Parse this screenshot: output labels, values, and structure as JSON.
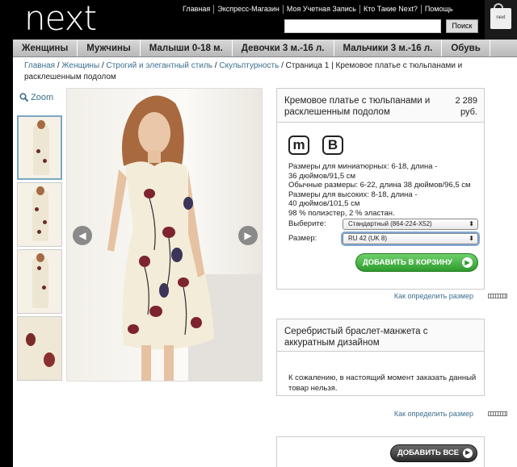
{
  "header": {
    "logo": "next",
    "links": [
      "Главная",
      "Экспресс-Магазин",
      "Моя Учетная Запись",
      "Кто Такие Next?",
      "Помощь"
    ],
    "search_button": "Поиск",
    "bag_label": "next"
  },
  "nav": [
    "Женщины",
    "Мужчины",
    "Малыши 0-18 м.",
    "Девочки 3 м.-16 л.",
    "Мальчики 3 м.-16 л.",
    "Обувь"
  ],
  "breadcrumb": {
    "links": [
      "Главная",
      "Женщины",
      "Строгий и элегантный стиль",
      "Скульптурность"
    ],
    "rest": "Страница 1  |  Кремовое платье с тюльпанами и расклешенным подолом"
  },
  "zoom": "Zoom",
  "gallery": {
    "prev": "◀",
    "next": "▶"
  },
  "product": {
    "title": "Кремовое платье с тюльпанами и расклешенным подолом",
    "price_value": "2 289",
    "price_unit": "руб.",
    "icon_m": "m",
    "icon_b": "B",
    "desc_lines": [
      "Размеры для миниатюрных: 6-18, длина -",
      "36 дюймов/91,5 см",
      "Обычные размеры: 6-22, длина 38 дюймов/96,5 см",
      "Размеры для высоких: 8-18, длина -",
      "40 дюймов/101,5 см",
      "98 % полиэстер, 2 % эластан."
    ],
    "choose_label": "Выберите:",
    "choose_value": "Стандартный (864-224-X52)",
    "size_label": "Размер:",
    "size_value": "RU 42 (UK 8)",
    "add_to_cart": "ДОБАВИТЬ В КОРЗИНУ",
    "size_help": "Как определить размер"
  },
  "related": {
    "title": "Серебристый браслет-манжета с аккуратным дизайном",
    "message": "К сожалению, в настоящий момент заказать данный товар нельзя.",
    "size_help": "Как определить размер"
  },
  "add_all": "ДОБАВИТЬ ВСЕ",
  "colors": {
    "accent_green": "#2e9b2c",
    "link": "#3a6e8f",
    "nav_bg": "#c8c8c8"
  }
}
